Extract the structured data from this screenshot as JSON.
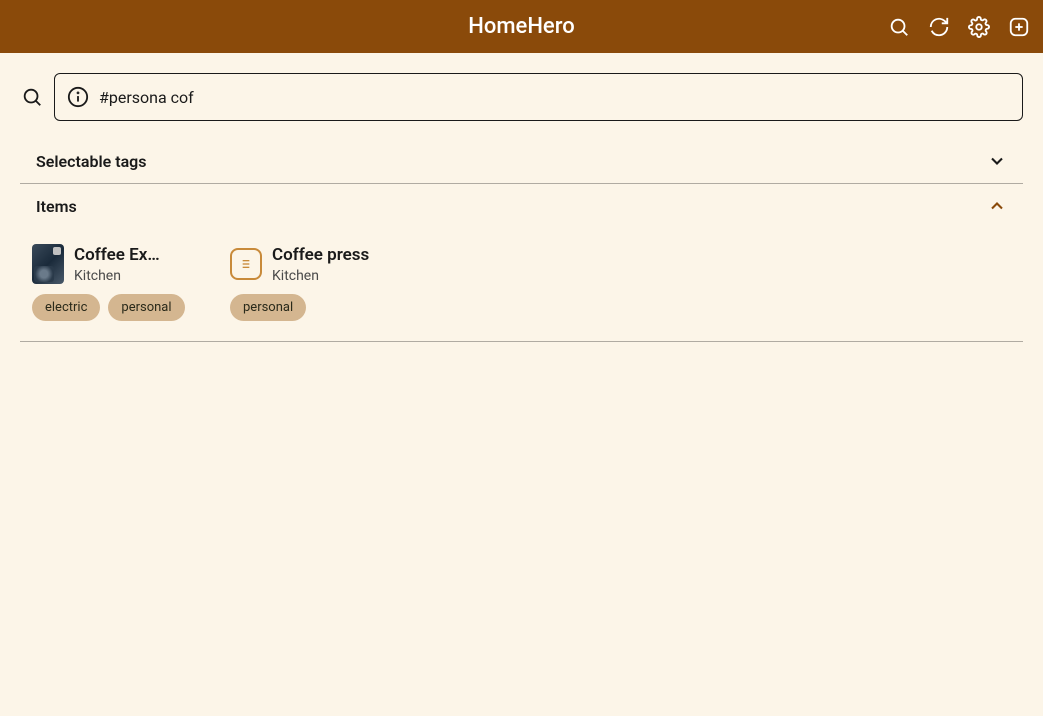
{
  "app": {
    "title": "HomeHero"
  },
  "icons": {
    "search": "search-icon",
    "refresh": "refresh-icon",
    "settings": "settings-icon",
    "add": "add-icon",
    "info": "info-icon"
  },
  "search": {
    "value": "#persona cof"
  },
  "sections": {
    "selectable_tags": {
      "title": "Selectable tags",
      "expanded": false
    },
    "items": {
      "title": "Items",
      "expanded": true,
      "list": [
        {
          "name": "Coffee Ex…",
          "location": "Kitchen",
          "thumb_type": "photo",
          "tags": [
            "electric",
            "personal"
          ]
        },
        {
          "name": "Coffee press",
          "location": "Kitchen",
          "thumb_type": "icon",
          "tags": [
            "personal"
          ]
        }
      ]
    }
  },
  "colors": {
    "primary": "#8a4a0a",
    "background": "#fcf5e8",
    "tag_bg": "#d4b690",
    "icon_accent": "#c88a3a"
  }
}
